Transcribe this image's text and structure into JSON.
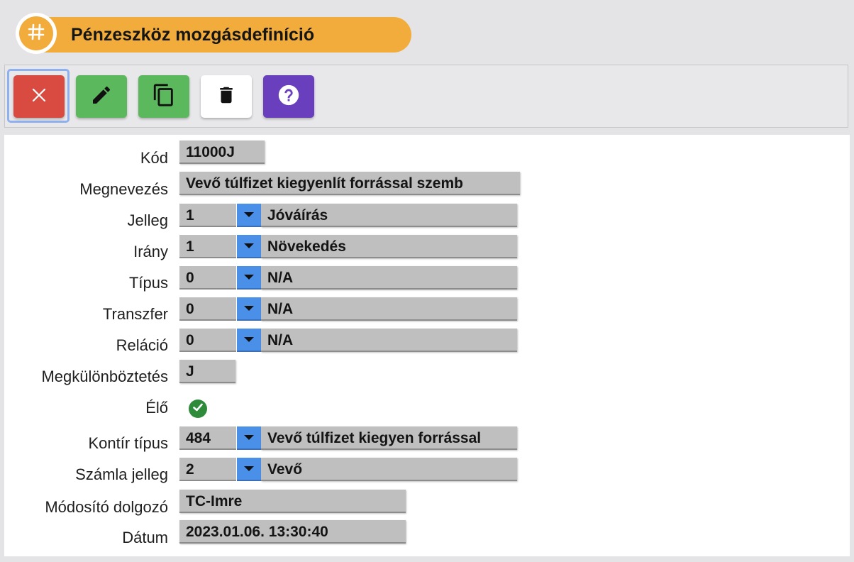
{
  "header": {
    "title": "Pénzeszköz mozgásdefiníció",
    "badge_icon": "hash-icon",
    "accent_color": "#f2ac3c"
  },
  "toolbar": {
    "buttons": [
      {
        "name": "cancel",
        "icon": "close-icon",
        "color": "#d94b40"
      },
      {
        "name": "edit",
        "icon": "pencil-icon",
        "color": "#5cb85c"
      },
      {
        "name": "copy",
        "icon": "copy-icon",
        "color": "#5cb85c"
      },
      {
        "name": "delete",
        "icon": "trash-icon",
        "color": "#ffffff"
      },
      {
        "name": "help",
        "icon": "help-icon",
        "color": "#6a3fbe"
      }
    ]
  },
  "form": {
    "kod": {
      "label": "Kód",
      "value": "11000J"
    },
    "megnevezes": {
      "label": "Megnevezés",
      "value": "Vevő túlfizet kiegyenlít forrással szemb"
    },
    "jelleg": {
      "label": "Jelleg",
      "code": "1",
      "name": "Jóváírás"
    },
    "irany": {
      "label": "Irány",
      "code": "1",
      "name": "Növekedés"
    },
    "tipus": {
      "label": "Típus",
      "code": "0",
      "name": "N/A"
    },
    "transzfer": {
      "label": "Transzfer",
      "code": "0",
      "name": "N/A"
    },
    "relacio": {
      "label": "Reláció",
      "code": "0",
      "name": "N/A"
    },
    "megkulonboztetes": {
      "label": "Megkülönböztetés",
      "value": "J"
    },
    "elo": {
      "label": "Élő",
      "checked": true,
      "icon": "check-circle-icon"
    },
    "kontir_tipus": {
      "label": "Kontír típus",
      "code": "484",
      "name": "Vevő túlfizet kiegyen forrással"
    },
    "szamla_jelleg": {
      "label": "Számla jelleg",
      "code": "2",
      "name": "Vevő"
    },
    "modosito_dolgozo": {
      "label": "Módosító dolgozó",
      "value": "TC-Imre"
    },
    "datum": {
      "label": "Dátum",
      "value": "2023.01.06. 13:30:40"
    }
  }
}
